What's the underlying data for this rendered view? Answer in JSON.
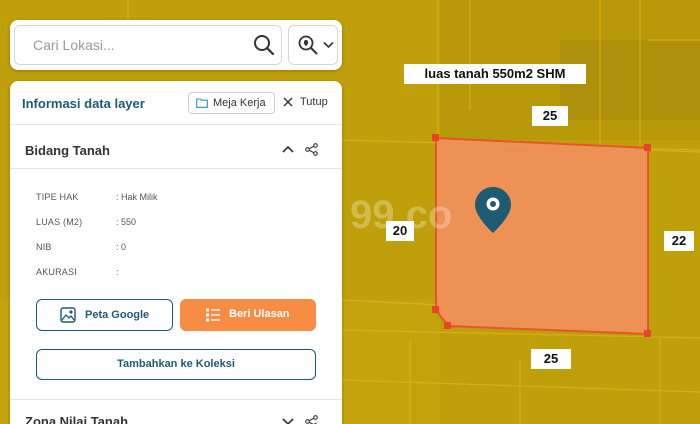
{
  "search": {
    "placeholder": "Cari Lokasi..."
  },
  "panel": {
    "title": "Informasi data layer",
    "meja_kerja_label": "Meja Kerja",
    "close_label": "Tutup",
    "section1": {
      "title": "Bidang Tanah",
      "attributes": [
        {
          "label": "TIPE HAK",
          "value": ": Hak Milik"
        },
        {
          "label": "LUAS (M2)",
          "value": ": 550"
        },
        {
          "label": "NIB",
          "value": ": 0"
        },
        {
          "label": "AKURASI",
          "value": ":"
        }
      ],
      "google_button": "Peta Google",
      "review_button": "Beri Ulasan",
      "collection_button": "Tambahkan ke Koleksi"
    },
    "section2": {
      "title": "Zona Nilai Tanah"
    }
  },
  "map": {
    "title_label": "luas tanah 550m2 SHM",
    "dim_top": "25",
    "dim_left": "20",
    "dim_right": "22",
    "dim_bottom": "25",
    "watermark": "99.co",
    "colors": {
      "base": "#bf9f0a",
      "parcel_fill": "#f0915a",
      "parcel_stroke": "#e8542a",
      "pin": "#1f5a73",
      "accent": "#f78c45",
      "primary": "#1f5a73"
    }
  }
}
